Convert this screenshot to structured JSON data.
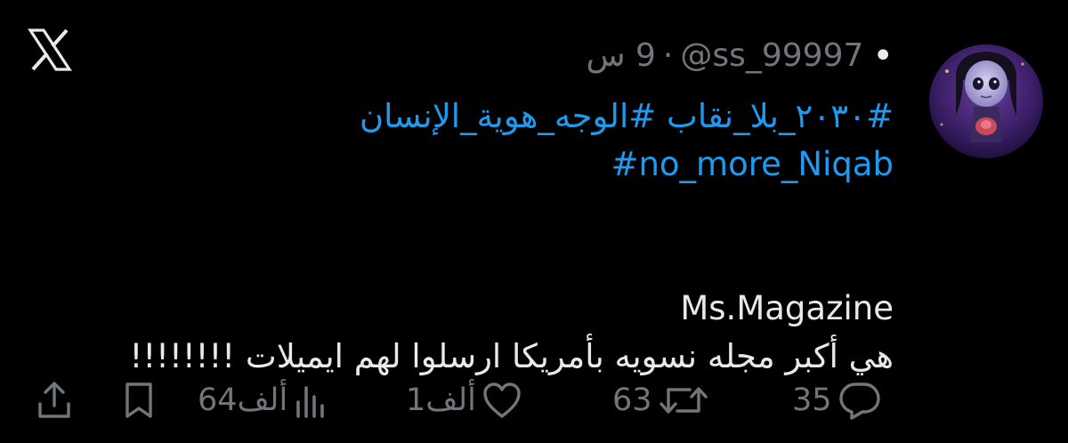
{
  "app": {
    "logo_icon": "x-logo-icon"
  },
  "tweet": {
    "avatar_icon": "avatar-image",
    "dot": "•",
    "handle": "@ss_99997",
    "separator": "·",
    "time": "9 س",
    "hashtags_line1": "#٢٠٣٠_بلا_نقاب #الوجه_هوية_الإنسان",
    "hashtags_line2": "#no_more_Niqab",
    "magazine": "Ms.Magazine",
    "body_line": "هي أكبر مجله نسويه بأمريكا ارسلوا لهم ايميلات !!!!!!!!"
  },
  "actions": {
    "reply": {
      "icon": "reply-icon",
      "count": "35"
    },
    "retweet": {
      "icon": "retweet-icon",
      "count": "63"
    },
    "like": {
      "icon": "heart-icon",
      "count": "1ألف"
    },
    "views": {
      "icon": "views-icon",
      "count": "64ألف"
    },
    "bookmark": {
      "icon": "bookmark-icon"
    },
    "share": {
      "icon": "share-icon"
    }
  },
  "colors": {
    "background": "#000000",
    "text": "#e7e9ea",
    "muted": "#71767b",
    "link": "#1d9bf0"
  }
}
